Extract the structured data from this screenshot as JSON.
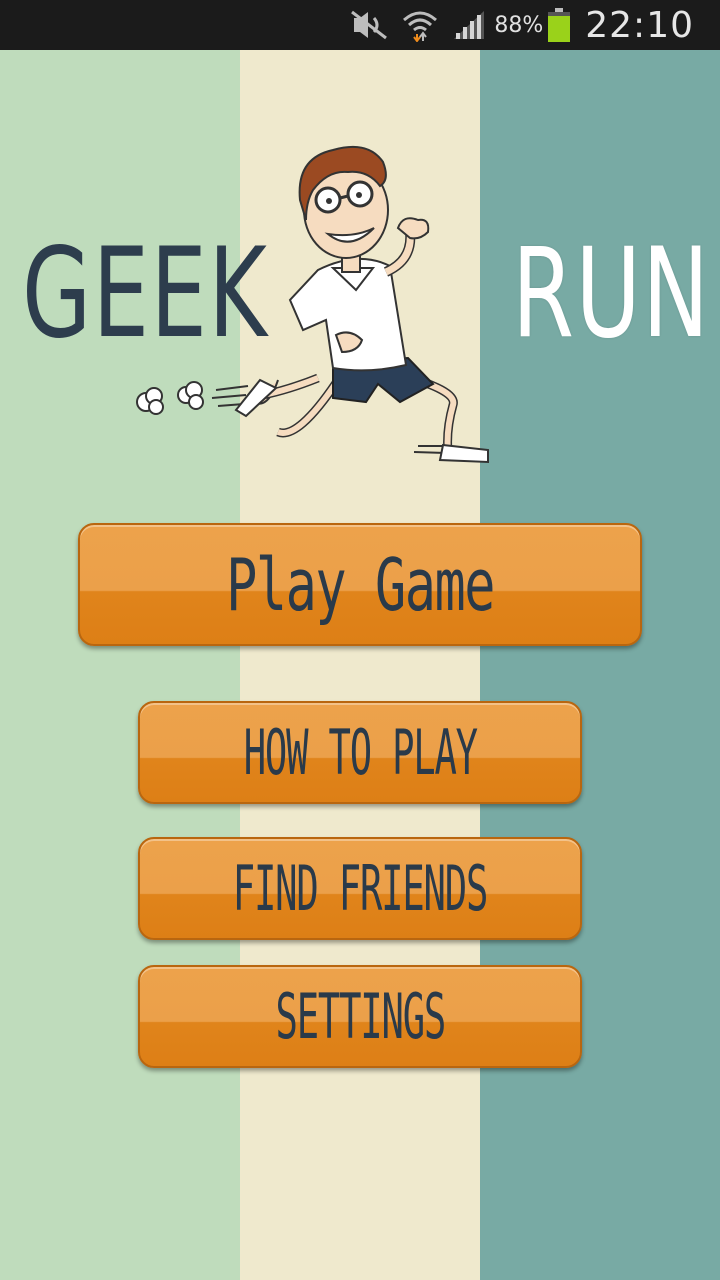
{
  "status_bar": {
    "battery_percent": "88%",
    "time": "22:10",
    "icons": [
      "mute-icon",
      "wifi-icon",
      "signal-icon",
      "battery-icon"
    ]
  },
  "title": {
    "left": "GEEK",
    "right": "RUN"
  },
  "colors": {
    "stripe_left": "#bfdcbc",
    "stripe_mid": "#efe9cd",
    "stripe_right": "#78aaa4",
    "button_orange": "#e58a22",
    "title_dark": "#2d3d4d"
  },
  "menu": {
    "play": "Play Game",
    "how_to_play": "HOW TO PLAY",
    "find_friends": "FIND FRIENDS",
    "settings": "SETTINGS"
  }
}
